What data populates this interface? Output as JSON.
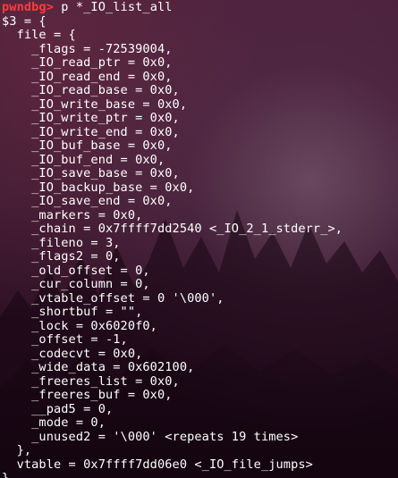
{
  "terminal": {
    "prompt": "pwndbg>",
    "command": " p *_IO_list_all",
    "lines": [
      "$3 = {",
      "  file = {",
      "    _flags = -72539004,",
      "    _IO_read_ptr = 0x0,",
      "    _IO_read_end = 0x0,",
      "    _IO_read_base = 0x0,",
      "    _IO_write_base = 0x0,",
      "    _IO_write_ptr = 0x0,",
      "    _IO_write_end = 0x0,",
      "    _IO_buf_base = 0x0,",
      "    _IO_buf_end = 0x0,",
      "    _IO_save_base = 0x0,",
      "    _IO_backup_base = 0x0,",
      "    _IO_save_end = 0x0,",
      "    _markers = 0x0,",
      "    _chain = 0x7ffff7dd2540 <_IO_2_1_stderr_>,",
      "    _fileno = 3,",
      "    _flags2 = 0,",
      "    _old_offset = 0,",
      "    _cur_column = 0,",
      "    _vtable_offset = 0 '\\000',",
      "    _shortbuf = \"\",",
      "    _lock = 0x6020f0,",
      "    _offset = -1,",
      "    _codecvt = 0x0,",
      "    _wide_data = 0x602100,",
      "    _freeres_list = 0x0,",
      "    _freeres_buf = 0x0,",
      "    __pad5 = 0,",
      "    _mode = 0,",
      "    _unused2 = '\\000' <repeats 19 times>",
      "  },",
      "  vtable = 0x7ffff7dd06e0 <_IO_file_jumps>",
      "}"
    ]
  },
  "colors": {
    "prompt": "#ff3b3b",
    "text": "#ffffff",
    "background": "#2c0f24"
  }
}
